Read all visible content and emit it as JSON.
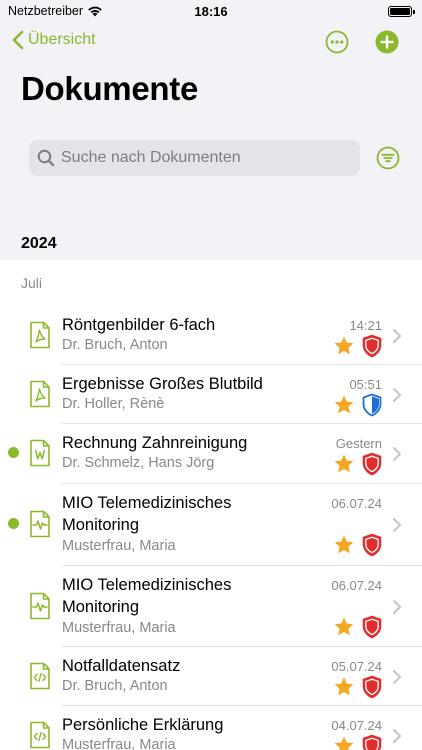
{
  "status_bar": {
    "carrier": "Netzbetreiber",
    "time": "18:16",
    "battery_level": 1.0
  },
  "nav": {
    "back_label": "Übersicht",
    "more_icon": "ellipsis-circle-icon",
    "add_icon": "plus-circle-icon"
  },
  "page": {
    "title": "Dokumente"
  },
  "search": {
    "placeholder": "Suche nach Dokumenten",
    "value": ""
  },
  "filter_icon": "filter-lines-icon",
  "section": {
    "year": "2024",
    "month": "Juli"
  },
  "colors": {
    "accent": "#8cb82c",
    "star": "#f5a623",
    "shield_red": "#e02e2e",
    "shield_blue": "#1f6fd6"
  },
  "documents": [
    {
      "title": "Röntgenbilder 6-fach",
      "author": "Dr. Bruch, Anton",
      "date": "14:21",
      "file_type": "pdf",
      "starred": true,
      "shield": "red",
      "unread": false
    },
    {
      "title": "Ergebnisse Großes Blutbild",
      "author": "Dr. Holler, Rènè",
      "date": "05:51",
      "file_type": "pdf",
      "starred": true,
      "shield": "blue",
      "unread": false
    },
    {
      "title": "Rechnung Zahnreinigung",
      "author": "Dr. Schmelz, Hans Jörg",
      "date": "Gestern",
      "file_type": "word",
      "starred": true,
      "shield": "red",
      "unread": true
    },
    {
      "title": "MIO Telemedizinisches Monitoring",
      "author": "Musterfrau, Maria",
      "date": "06.07.24",
      "file_type": "monitoring",
      "starred": true,
      "shield": "red",
      "unread": true
    },
    {
      "title": "MIO Telemedizinisches Monitoring",
      "author": "Musterfrau, Maria",
      "date": "06.07.24",
      "file_type": "monitoring",
      "starred": true,
      "shield": "red",
      "unread": false
    },
    {
      "title": "Notfalldatensatz",
      "author": "Dr. Bruch, Anton",
      "date": "05.07.24",
      "file_type": "code",
      "starred": true,
      "shield": "red",
      "unread": false
    },
    {
      "title": "Persönliche Erklärung",
      "author": "Musterfrau, Maria",
      "date": "04.07.24",
      "file_type": "code",
      "starred": true,
      "shield": "red",
      "unread": false
    }
  ]
}
